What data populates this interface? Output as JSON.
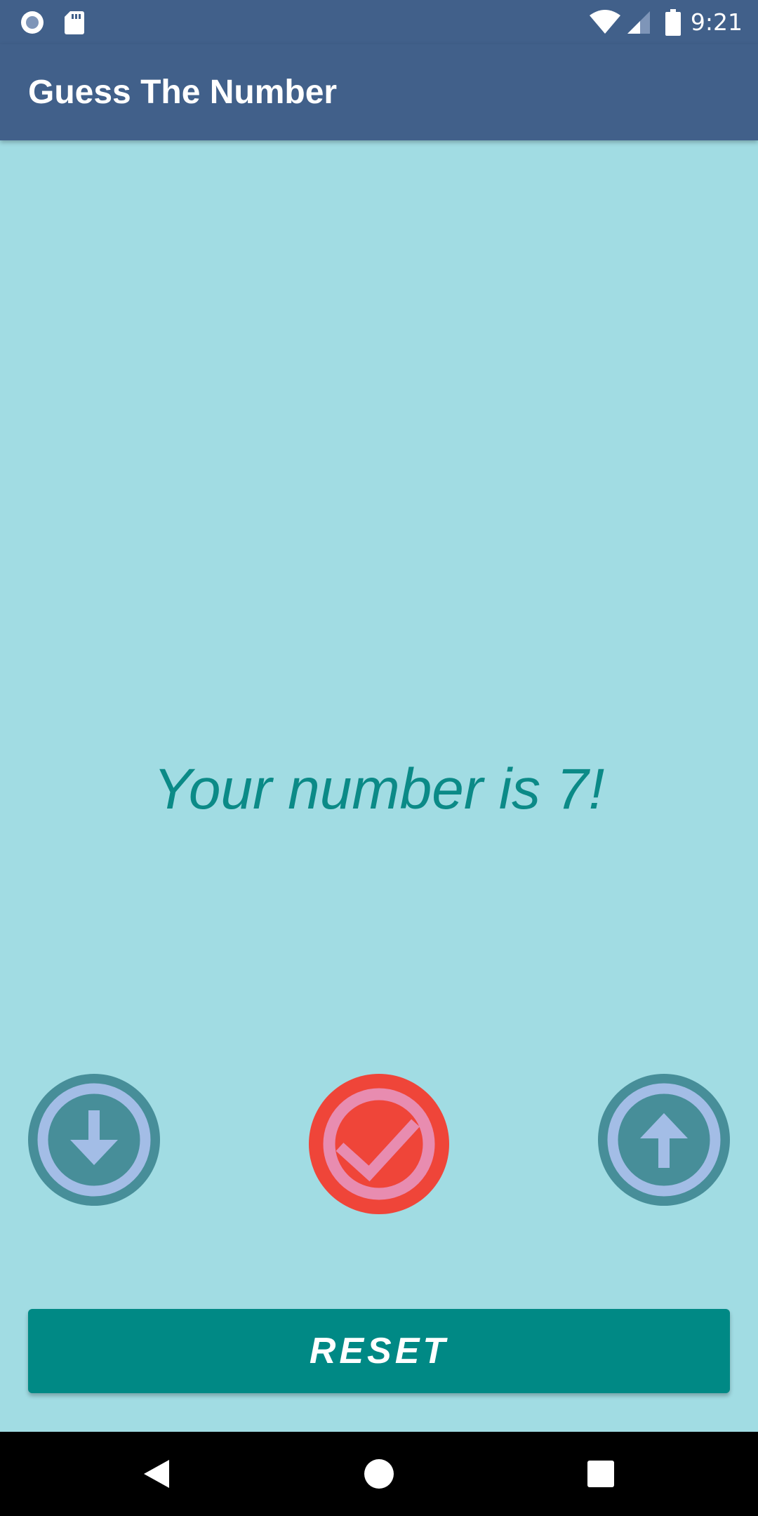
{
  "status_bar": {
    "time": "9:21",
    "left_icons": [
      "record-indicator-icon",
      "sd-card-icon"
    ],
    "right_icons": [
      "wifi-icon",
      "cell-signal-icon",
      "battery-icon"
    ]
  },
  "app_bar": {
    "title": "Guess The Number"
  },
  "main": {
    "result_text": "Your number is 7!",
    "buttons": [
      {
        "name": "lower",
        "icon": "arrow-down-icon"
      },
      {
        "name": "correct",
        "icon": "checkmark-icon"
      },
      {
        "name": "higher",
        "icon": "arrow-up-icon"
      }
    ],
    "reset_label": "RESET"
  },
  "nav_bar": {
    "buttons": [
      "back-icon",
      "home-icon",
      "recents-icon"
    ]
  },
  "colors": {
    "app_bar": "#41608A",
    "background": "#A1DCE3",
    "accent_teal": "#008985",
    "result_text": "#0B8A87",
    "correct_red": "#EF4539",
    "correct_ring": "#E88CB0",
    "guess_button": "#478E99",
    "guess_ring": "#A3BDE6"
  }
}
